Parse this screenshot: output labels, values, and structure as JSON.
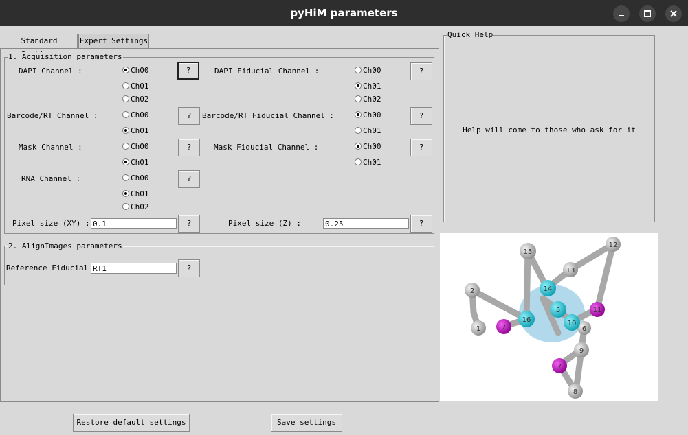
{
  "window": {
    "title": "pyHiM parameters",
    "controls": [
      "minimize-icon",
      "maximize-icon",
      "close-icon"
    ]
  },
  "tabs": [
    {
      "label": "Standard Settings",
      "selected": true
    },
    {
      "label": "Expert Settings",
      "selected": false
    }
  ],
  "acquisition": {
    "legend": "1. Acquisition parameters",
    "dapi": {
      "label": "DAPI Channel :",
      "options": [
        "Ch00",
        "Ch01",
        "Ch02"
      ],
      "selected": "Ch00"
    },
    "dapi_fiducial": {
      "label": "DAPI Fiducial Channel :",
      "options": [
        "Ch00",
        "Ch01",
        "Ch02"
      ],
      "selected": "Ch01"
    },
    "barcode": {
      "label": "Barcode/RT Channel :",
      "options": [
        "Ch00",
        "Ch01"
      ],
      "selected": "Ch01"
    },
    "barcode_fiducial": {
      "label": "Barcode/RT Fiducial Channel :",
      "options": [
        "Ch00",
        "Ch01"
      ],
      "selected": "Ch00"
    },
    "mask": {
      "label": "Mask Channel :",
      "options": [
        "Ch00",
        "Ch01"
      ],
      "selected": "Ch01"
    },
    "mask_fiducial": {
      "label": "Mask Fiducial Channel :",
      "options": [
        "Ch00",
        "Ch01"
      ],
      "selected": "Ch00"
    },
    "rna": {
      "label": "RNA Channel :",
      "options": [
        "Ch00",
        "Ch01",
        "Ch02"
      ],
      "selected": "Ch01"
    },
    "pixel_xy": {
      "label": "Pixel size (XY) :",
      "value": "0.1"
    },
    "pixel_z": {
      "label": "Pixel size (Z) :",
      "value": "0.25"
    }
  },
  "align": {
    "legend": "2. AlignImages parameters",
    "reference": {
      "label": "Reference Fiducial :",
      "value": "RT1"
    }
  },
  "help_button_label": "?",
  "quick_help": {
    "legend": "Quick Help",
    "text": "Help will come to those who ask for it"
  },
  "molecule": {
    "white_nodes": [
      "1",
      "2",
      "6",
      "8",
      "9",
      "12",
      "13",
      "15"
    ],
    "cyan_nodes": [
      "5",
      "10",
      "14",
      "16"
    ],
    "magenta_nodes": [
      "7",
      "11"
    ],
    "colors": {
      "white": "#bdbdbd",
      "cyan": "#1ec8d6",
      "magenta": "#c800c8",
      "bond": "#a8a8a8",
      "halo": "#9fd0e6"
    }
  },
  "footer": {
    "restore_label": "Restore default settings",
    "save_label": "Save settings"
  },
  "colors": {
    "titlebar": "#2e2e2e",
    "background": "#d9d9d9",
    "window_button": "#474747"
  }
}
